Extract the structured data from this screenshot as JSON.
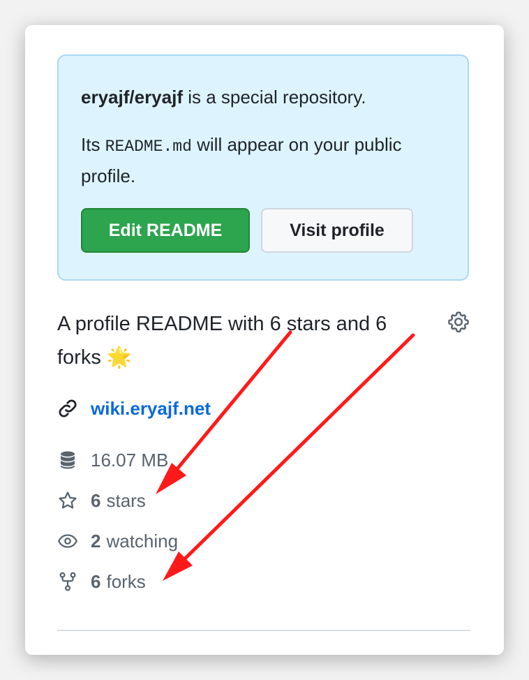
{
  "notice": {
    "repo_name": "eryajf/eryajf",
    "special_text": " is a special repository.",
    "readme_prefix": "Its ",
    "readme_file": "README.md",
    "readme_suffix": " will appear on your public profile.",
    "edit_button": "Edit README",
    "visit_button": "Visit profile"
  },
  "about": {
    "description": "A profile README with 6 stars and 6 forks",
    "emoji": "🌟",
    "settings_icon": "gear-icon"
  },
  "meta": {
    "website": "wiki.eryajf.net",
    "size": "16.07 MB",
    "stars_count": "6",
    "stars_label": "stars",
    "watching_count": "2",
    "watching_label": "watching",
    "forks_count": "6",
    "forks_label": "forks"
  },
  "colors": {
    "notice_bg": "#ddf4ff",
    "primary_button": "#2da44e",
    "link": "#0969da",
    "annotation_arrow": "#ff1a1a"
  }
}
